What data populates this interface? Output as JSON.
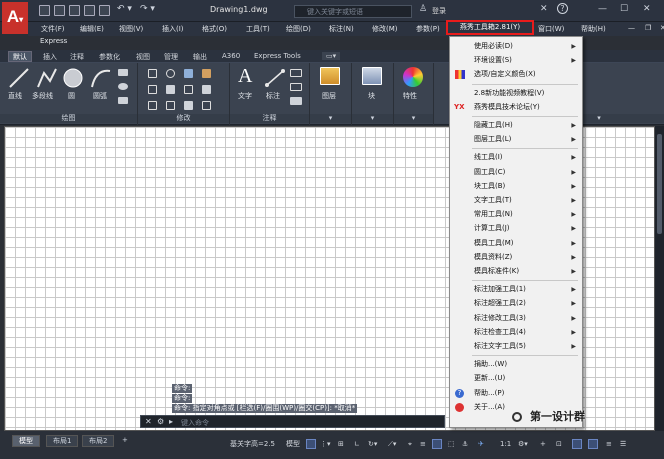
{
  "window": {
    "title": "Drawing1.dwg",
    "search_placeholder": "键入关键字或短语",
    "user": "登录",
    "help": "?"
  },
  "menubar": {
    "items": [
      "文件(F)",
      "编辑(E)",
      "视图(V)",
      "插入(I)",
      "格式(O)",
      "工具(T)",
      "绘图(D)",
      "标注(N)",
      "修改(M)",
      "参数(P)",
      "窗口(W)",
      "帮助(H)"
    ],
    "plugin": "燕秀工具箱2.81(Y)",
    "express": "Express"
  },
  "ribbon_tabs": [
    "默认",
    "插入",
    "注释",
    "参数化",
    "视图",
    "管理",
    "输出",
    "A360",
    "Express Tools"
  ],
  "ribbon": {
    "tools": [
      "直线",
      "多段线",
      "圆",
      "圆弧",
      "文字",
      "标注",
      "图层",
      "块",
      "特性"
    ],
    "panels": [
      "绘图",
      "修改",
      "注释"
    ]
  },
  "command": {
    "history": [
      "命令:",
      "命令:",
      "命令: 指定对角点或 [栏选(F)/圈围(WP)/圈交(CP)]: *取消*"
    ],
    "placeholder": "键入命令"
  },
  "layout_tabs": [
    "模型",
    "布局1",
    "布局2",
    "+"
  ],
  "status": {
    "annotation": "基关字高=2.5",
    "model": "模型",
    "scale": "1:1"
  },
  "dropdown": {
    "items": [
      {
        "label": "使用必读(D)",
        "arrow": true,
        "sep_after": false,
        "icon": ""
      },
      {
        "label": "环境设置(S)",
        "arrow": true,
        "sep_after": false,
        "icon": ""
      },
      {
        "label": "选项/自定义颜色(X)",
        "arrow": false,
        "sep_after": true,
        "icon": "palette-icon"
      },
      {
        "label": "2.8新功能视频教程(V)",
        "arrow": false,
        "sep_after": false,
        "icon": ""
      },
      {
        "label": "燕秀模具技术论坛(Y)",
        "arrow": false,
        "sep_after": true,
        "icon": "yx-icon"
      },
      {
        "label": "隐藏工具(H)",
        "arrow": true,
        "sep_after": false,
        "icon": ""
      },
      {
        "label": "图层工具(L)",
        "arrow": true,
        "sep_after": true,
        "icon": ""
      },
      {
        "label": "线工具(I)",
        "arrow": true,
        "sep_after": false,
        "icon": ""
      },
      {
        "label": "圆工具(C)",
        "arrow": true,
        "sep_after": false,
        "icon": ""
      },
      {
        "label": "块工具(B)",
        "arrow": true,
        "sep_after": false,
        "icon": ""
      },
      {
        "label": "文字工具(T)",
        "arrow": true,
        "sep_after": false,
        "icon": ""
      },
      {
        "label": "常用工具(N)",
        "arrow": true,
        "sep_after": false,
        "icon": ""
      },
      {
        "label": "计算工具(J)",
        "arrow": true,
        "sep_after": false,
        "icon": ""
      },
      {
        "label": "模具工具(M)",
        "arrow": true,
        "sep_after": false,
        "icon": ""
      },
      {
        "label": "模具资料(Z)",
        "arrow": true,
        "sep_after": false,
        "icon": ""
      },
      {
        "label": "模具标准件(K)",
        "arrow": true,
        "sep_after": true,
        "icon": ""
      },
      {
        "label": "标注加强工具(1)",
        "arrow": true,
        "sep_after": false,
        "icon": ""
      },
      {
        "label": "标注超强工具(2)",
        "arrow": true,
        "sep_after": false,
        "icon": ""
      },
      {
        "label": "标注修改工具(3)",
        "arrow": true,
        "sep_after": false,
        "icon": ""
      },
      {
        "label": "标注检查工具(4)",
        "arrow": true,
        "sep_after": false,
        "icon": ""
      },
      {
        "label": "标注文字工具(5)",
        "arrow": true,
        "sep_after": true,
        "icon": ""
      },
      {
        "label": "捐助...(W)",
        "arrow": false,
        "sep_after": false,
        "icon": ""
      },
      {
        "label": "更新...(U)",
        "arrow": false,
        "sep_after": false,
        "icon": ""
      },
      {
        "label": "帮助...(P)",
        "arrow": false,
        "sep_after": false,
        "icon": "help-icon"
      },
      {
        "label": "关于...(A)",
        "arrow": false,
        "sep_after": false,
        "icon": "about-icon"
      }
    ]
  },
  "watermark": "第一设计群",
  "colors": {
    "accent": "#e81b1b",
    "brand": "#c8312b",
    "highlight": "#3c4f76"
  }
}
